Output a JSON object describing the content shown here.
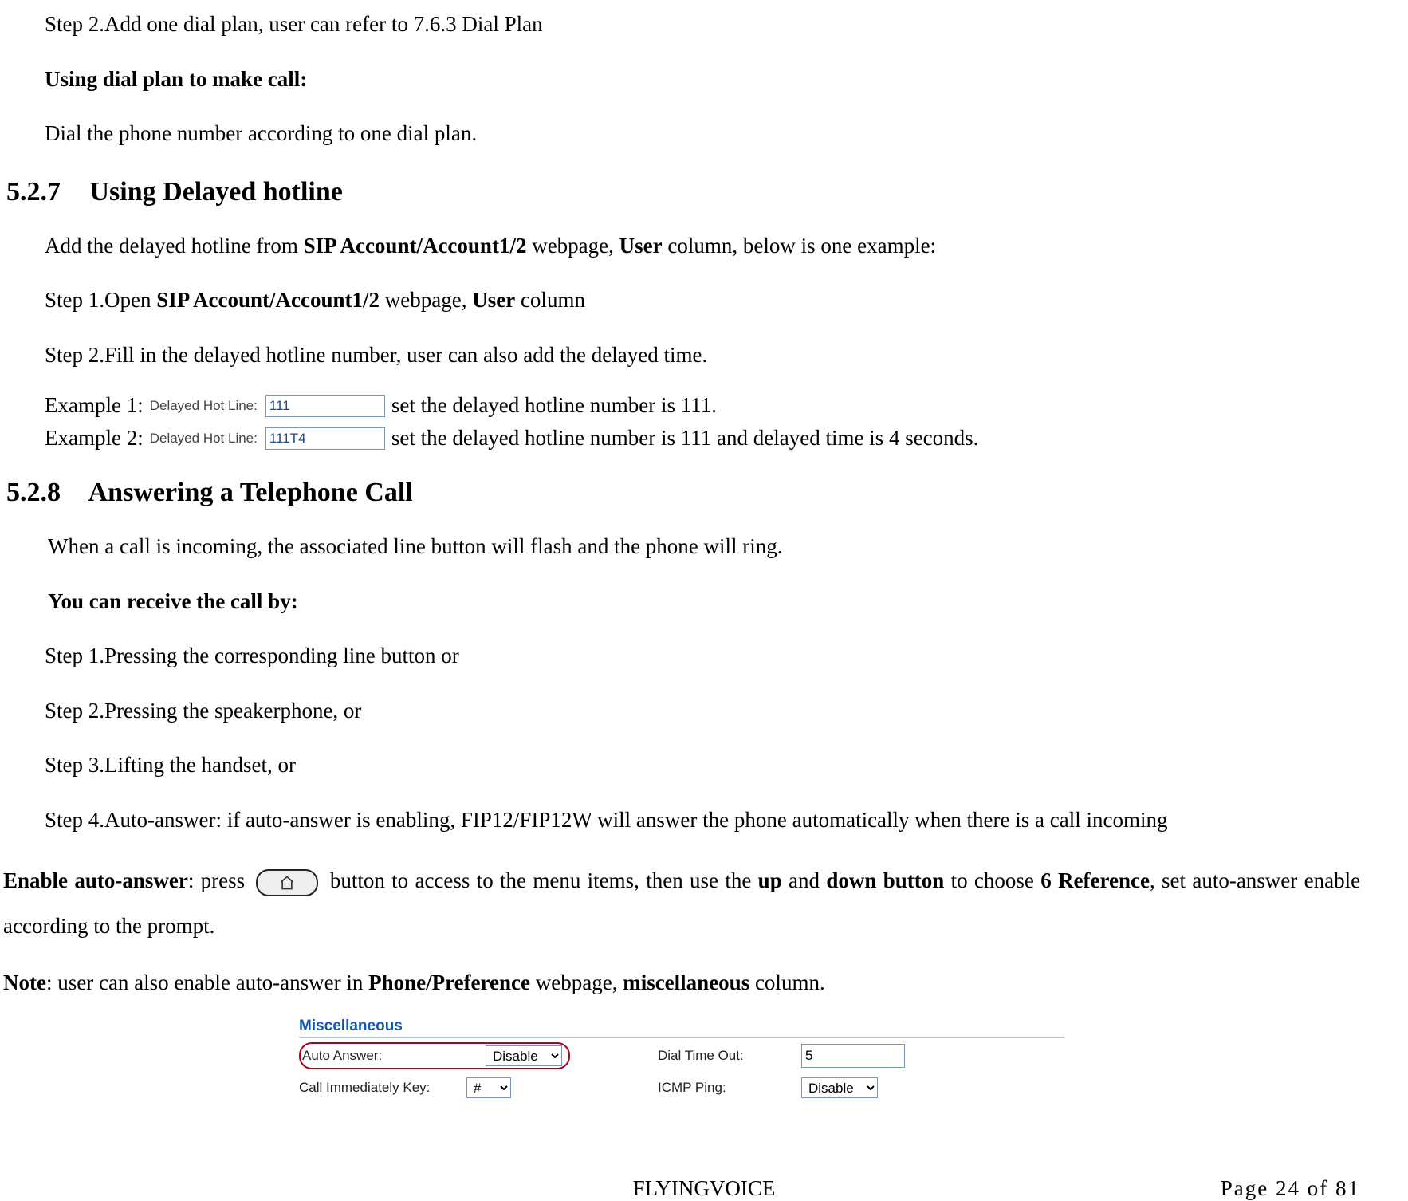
{
  "intro": {
    "step2": "Step 2.Add one dial plan, user can refer to 7.6.3 Dial Plan",
    "using_dial_plan_heading": "Using dial plan to make call:",
    "dial_instruction": "Dial the phone number according to one dial plan."
  },
  "sec527": {
    "number": "5.2.7",
    "title": "Using Delayed hotline",
    "intro_pre": "Add the delayed hotline from ",
    "intro_b1": "SIP Account/Account1/2",
    "intro_mid1": " webpage, ",
    "intro_b2": "User",
    "intro_post": " column, below is one example:",
    "step1_pre": "Step 1.Open ",
    "step1_b1": "SIP Account/Account1/2",
    "step1_mid": " webpage, ",
    "step1_b2": "User",
    "step1_post": " column",
    "step2": "Step 2.Fill in the delayed hotline number, user can also add the delayed time.",
    "ex1_label": "Example 1:",
    "ex2_label": "Example 2:",
    "ui_field_label": "Delayed Hot Line:",
    "ex1_value": "111",
    "ex2_value": "111T4",
    "ex1_desc": " set the delayed hotline number is 111.",
    "ex2_desc": "set the delayed hotline number is 111 and delayed time is 4 seconds."
  },
  "sec528": {
    "number": "5.2.8",
    "title": "Answering a Telephone Call",
    "intro": "When a call is incoming, the associated line button will flash and the phone will ring.",
    "receive_heading": "You can receive the call by:",
    "step1": "Step 1.Pressing the corresponding line button or",
    "step2": "Step 2.Pressing the speakerphone, or",
    "step3": "Step 3.Lifting the handset, or",
    "step4": "Step 4.Auto-answer: if auto-answer is enabling, FIP12/FIP12W will answer the phone automatically when there is a call incoming",
    "enable_pre_b": "Enable auto-answer",
    "enable_pre": ": press ",
    "enable_mid": " button to access to the menu items, then use the ",
    "enable_b_up": "up",
    "enable_and": " and ",
    "enable_b_down": "down button",
    "enable_mid2": " to choose ",
    "enable_b_ref": "6 Reference",
    "enable_post": ", set auto-answer enable according to the prompt.",
    "note_b": "Note",
    "note_pre": ": user can also enable auto-answer in ",
    "note_b1": "Phone/Preference",
    "note_mid": " webpage, ",
    "note_b2": "miscellaneous",
    "note_post": " column."
  },
  "misc": {
    "title": "Miscellaneous",
    "auto_answer_label": "Auto Answer:",
    "auto_answer_value": "Disable",
    "call_immediately_label": "Call Immediately Key:",
    "call_immediately_value": "#",
    "dial_timeout_label": "Dial Time Out:",
    "dial_timeout_value": "5",
    "icmp_label": "ICMP Ping:",
    "icmp_value": "Disable"
  },
  "footer": {
    "brand": "FLYINGVOICE",
    "page": "Page  24  of  81"
  }
}
